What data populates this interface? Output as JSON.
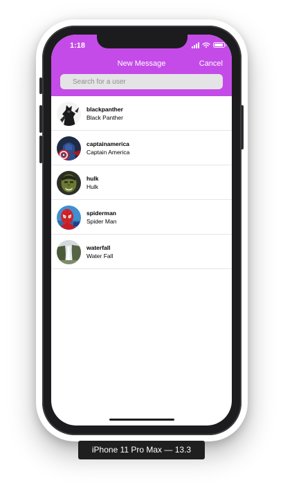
{
  "status_bar": {
    "time": "1:18"
  },
  "nav": {
    "title": "New Message",
    "cancel_label": "Cancel"
  },
  "search": {
    "placeholder": "Search for a user",
    "value": ""
  },
  "users": [
    {
      "username": "blackpanther",
      "fullname": "Black Panther",
      "avatar": "black-panther-avatar"
    },
    {
      "username": "captainamerica",
      "fullname": "Captain America",
      "avatar": "captain-america-avatar"
    },
    {
      "username": "hulk",
      "fullname": "Hulk",
      "avatar": "hulk-avatar"
    },
    {
      "username": "spiderman",
      "fullname": "Spider Man",
      "avatar": "spider-man-avatar"
    },
    {
      "username": "waterfall",
      "fullname": "Water Fall",
      "avatar": "waterfall-avatar"
    }
  ],
  "device_label": "iPhone 11 Pro Max — 13.3",
  "colors": {
    "header": "#c44be8",
    "device_frame": "#1c1c1e",
    "label_background": "#1f1f1f"
  },
  "icons": [
    "search-icon",
    "wifi-icon",
    "cellular-signal-icon",
    "battery-icon"
  ]
}
